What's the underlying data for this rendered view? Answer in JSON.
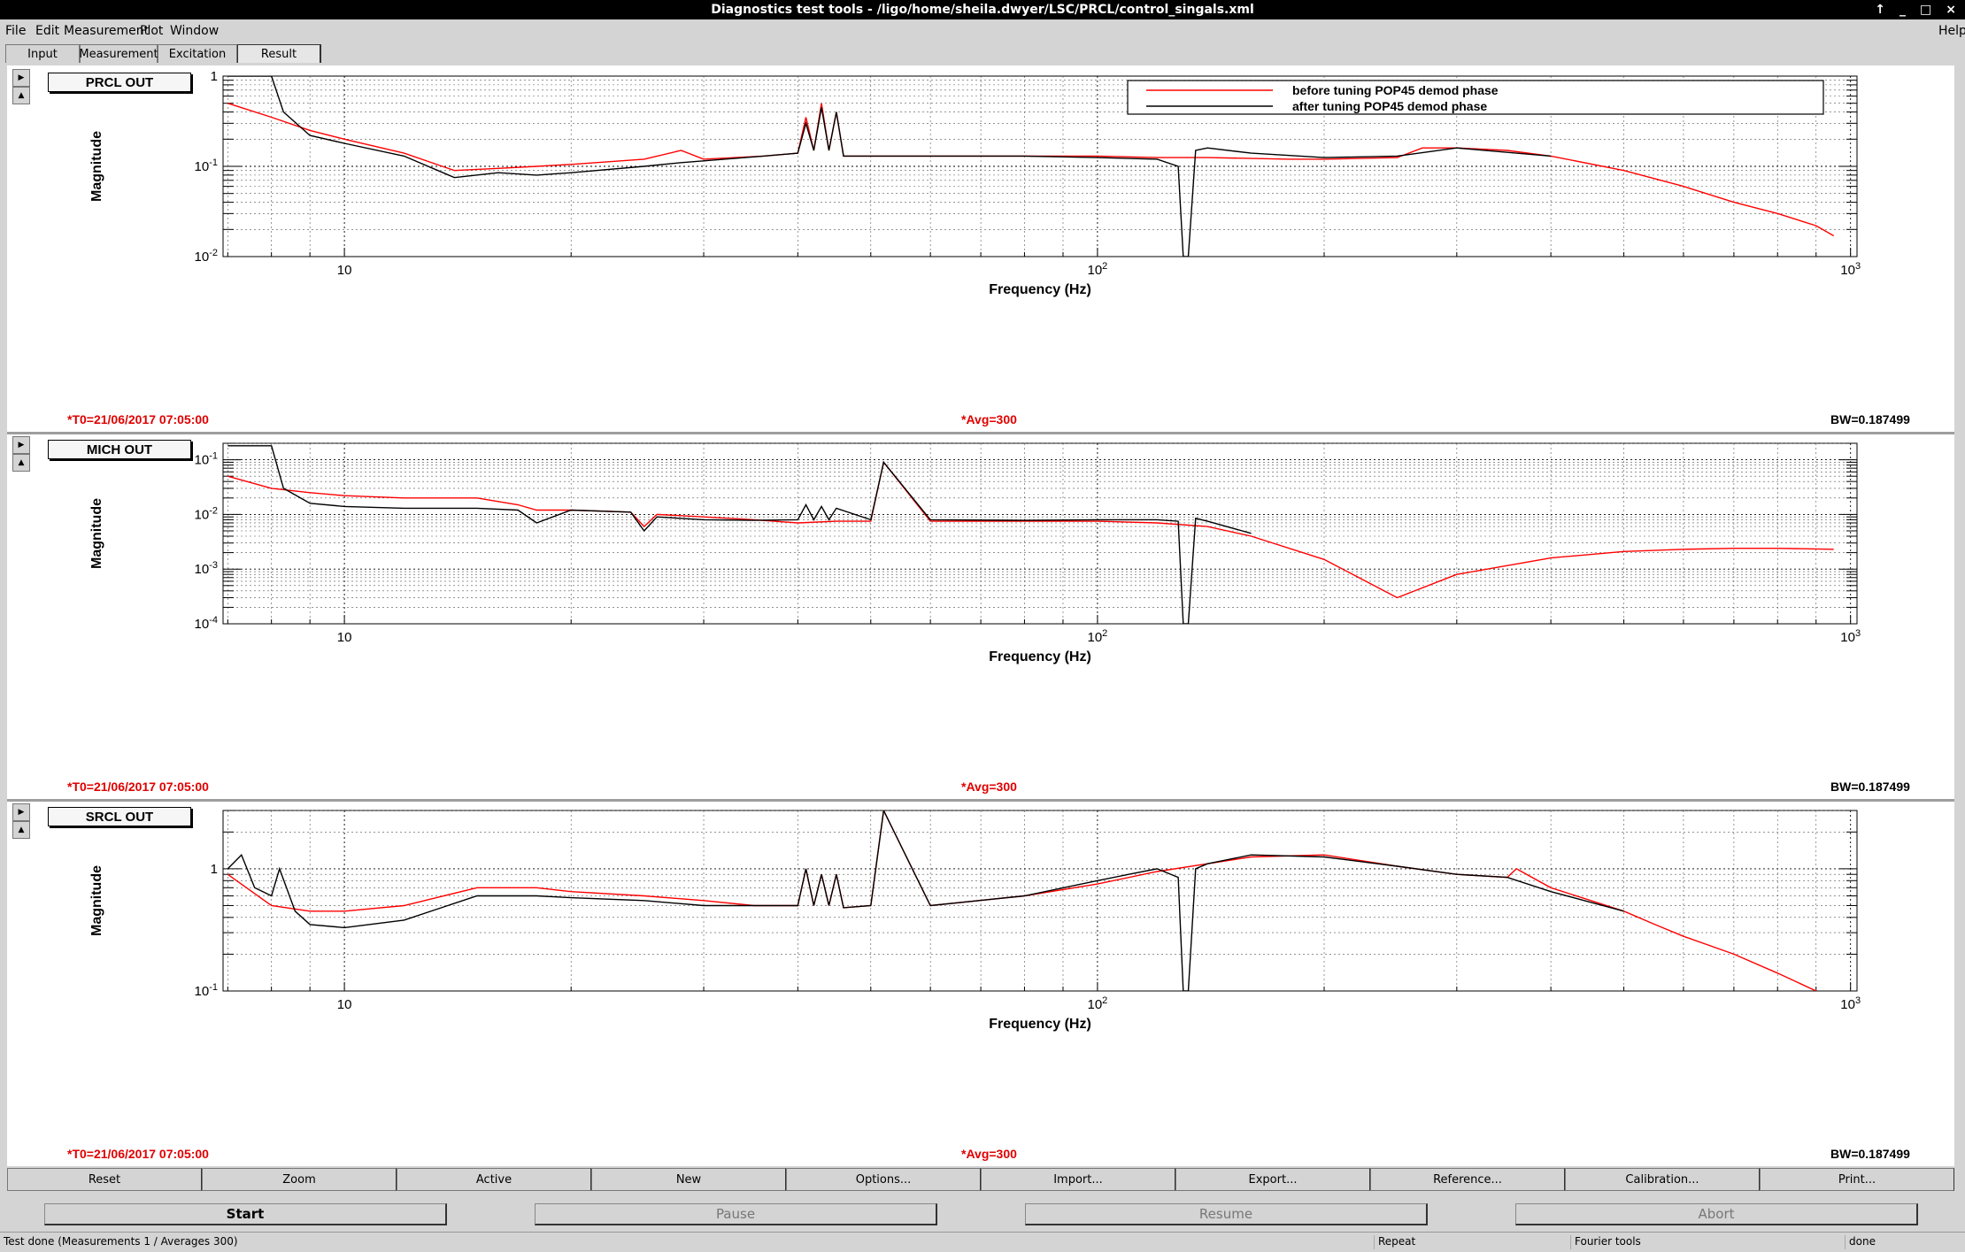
{
  "window": {
    "title": "Diagnostics test tools - /ligo/home/sheila.dwyer/LSC/PRCL/control_singals.xml",
    "controls": [
      "↑",
      "_",
      "□",
      "×"
    ]
  },
  "menu": {
    "file": "File",
    "edit": "Edit",
    "measurement": "Measurement",
    "plot": "Plot",
    "window": "Window",
    "help": "Help"
  },
  "tabs": [
    "Input",
    "Measurement",
    "Excitation",
    "Result"
  ],
  "legend": {
    "before": "before tuning POP45 demod phase",
    "after": "after tuning POP45 demod phase"
  },
  "colors": {
    "before": "#ff0000",
    "after": "#000000",
    "timestamp": "#e00000"
  },
  "plots": [
    {
      "label": "PRCL OUT",
      "ylabel": "Magnitude",
      "xlabel": "Frequency (Hz)",
      "t0": "*T0=21/06/2017 07:05:00",
      "avg": "*Avg=300",
      "bw": "BW=0.187499"
    },
    {
      "label": "MICH OUT",
      "ylabel": "Magnitude",
      "xlabel": "Frequency (Hz)",
      "t0": "*T0=21/06/2017 07:05:00",
      "avg": "*Avg=300",
      "bw": "BW=0.187499"
    },
    {
      "label": "SRCL OUT",
      "ylabel": "Magnitude",
      "xlabel": "Frequency (Hz)",
      "t0": "*T0=21/06/2017 07:05:00",
      "avg": "*Avg=300",
      "bw": "BW=0.187499"
    }
  ],
  "chart_data": [
    {
      "type": "line",
      "title": "PRCL OUT",
      "xlabel": "Frequency (Hz)",
      "ylabel": "Magnitude",
      "xscale": "log",
      "yscale": "log",
      "xlim": [
        6.9,
        1020
      ],
      "ylim": [
        0.01,
        1.0
      ],
      "xticks": [
        "10",
        "10^2",
        "10^3"
      ],
      "yticks": [
        "1",
        "10^-1",
        "10^-2"
      ],
      "grid": true,
      "legend_position": "top-right",
      "series": [
        {
          "name": "before tuning POP45 demod phase",
          "color": "#ff0000",
          "x": [
            7,
            8,
            9,
            10,
            12,
            14,
            16,
            18,
            20,
            25,
            28,
            30,
            36,
            40,
            41,
            42,
            43,
            44,
            45,
            46,
            50,
            55,
            60,
            70,
            80,
            100,
            120,
            140,
            180,
            200,
            250,
            270,
            300,
            350,
            400,
            500,
            600,
            700,
            800,
            900,
            950
          ],
          "y": [
            0.5,
            0.35,
            0.25,
            0.2,
            0.14,
            0.09,
            0.095,
            0.1,
            0.105,
            0.12,
            0.15,
            0.12,
            0.13,
            0.14,
            0.35,
            0.15,
            0.5,
            0.15,
            0.4,
            0.13,
            0.13,
            0.13,
            0.13,
            0.13,
            0.13,
            0.13,
            0.125,
            0.125,
            0.12,
            0.12,
            0.125,
            0.16,
            0.16,
            0.15,
            0.13,
            0.09,
            0.06,
            0.04,
            0.03,
            0.022,
            0.017
          ]
        },
        {
          "name": "after tuning POP45 demod phase",
          "color": "#000000",
          "x": [
            7,
            7.6,
            8,
            8.3,
            9,
            10,
            12,
            14,
            16,
            18,
            20,
            25,
            28,
            30,
            36,
            40,
            41,
            42,
            43,
            44,
            45,
            46,
            50,
            60,
            80,
            100,
            120,
            128,
            130,
            132,
            135,
            140,
            160,
            200,
            250,
            300,
            400
          ],
          "y": [
            1.0,
            1.0,
            1.0,
            0.4,
            0.22,
            0.18,
            0.13,
            0.075,
            0.085,
            0.08,
            0.085,
            0.1,
            0.11,
            0.115,
            0.13,
            0.14,
            0.3,
            0.15,
            0.45,
            0.15,
            0.4,
            0.13,
            0.13,
            0.13,
            0.13,
            0.125,
            0.12,
            0.1,
            0.01,
            0.01,
            0.15,
            0.16,
            0.14,
            0.125,
            0.13,
            0.16,
            0.13
          ]
        }
      ]
    },
    {
      "type": "line",
      "title": "MICH OUT",
      "xlabel": "Frequency (Hz)",
      "ylabel": "Magnitude",
      "xscale": "log",
      "yscale": "log",
      "xlim": [
        6.9,
        1020
      ],
      "ylim": [
        0.0001,
        0.2
      ],
      "xticks": [
        "10",
        "10^2",
        "10^3"
      ],
      "yticks": [
        "10^-1",
        "10^-2",
        "10^-3",
        "10^-4"
      ],
      "grid": true,
      "series": [
        {
          "name": "before tuning POP45 demod phase",
          "color": "#ff0000",
          "x": [
            7,
            8,
            9,
            10,
            12,
            15,
            17,
            18,
            20,
            24,
            25,
            26,
            30,
            35,
            40,
            45,
            50,
            52,
            60,
            80,
            100,
            120,
            140,
            160,
            200,
            250,
            300,
            400,
            500,
            600,
            700,
            800,
            950
          ],
          "y": [
            0.05,
            0.03,
            0.025,
            0.022,
            0.02,
            0.02,
            0.015,
            0.012,
            0.012,
            0.011,
            0.006,
            0.01,
            0.009,
            0.008,
            0.007,
            0.0075,
            0.0075,
            0.09,
            0.0075,
            0.0075,
            0.0075,
            0.007,
            0.006,
            0.004,
            0.0015,
            0.0003,
            0.0008,
            0.0016,
            0.0021,
            0.0023,
            0.0024,
            0.0024,
            0.0023
          ]
        },
        {
          "name": "after tuning POP45 demod phase",
          "color": "#000000",
          "x": [
            7,
            7.6,
            8,
            8.3,
            9,
            10,
            12,
            15,
            17,
            18,
            20,
            24,
            25,
            26,
            30,
            35,
            40,
            41,
            42,
            43,
            44,
            45,
            50,
            52,
            60,
            80,
            100,
            120,
            128,
            130,
            132,
            135,
            140,
            160
          ],
          "y": [
            0.18,
            0.18,
            0.18,
            0.03,
            0.016,
            0.014,
            0.013,
            0.013,
            0.012,
            0.007,
            0.012,
            0.011,
            0.005,
            0.009,
            0.008,
            0.0078,
            0.008,
            0.015,
            0.008,
            0.014,
            0.008,
            0.013,
            0.008,
            0.09,
            0.008,
            0.0078,
            0.008,
            0.008,
            0.0075,
            0.0001,
            0.0001,
            0.0085,
            0.0075,
            0.0045
          ]
        }
      ]
    },
    {
      "type": "line",
      "title": "SRCL OUT",
      "xlabel": "Frequency (Hz)",
      "ylabel": "Magnitude",
      "xscale": "log",
      "yscale": "log",
      "xlim": [
        6.9,
        1020
      ],
      "ylim": [
        0.1,
        3.0
      ],
      "xticks": [
        "10",
        "10^2",
        "10^3"
      ],
      "yticks": [
        "1",
        "10^-1"
      ],
      "grid": true,
      "series": [
        {
          "name": "before tuning POP45 demod phase",
          "color": "#ff0000",
          "x": [
            7,
            8,
            9,
            10,
            12,
            15,
            18,
            20,
            25,
            30,
            35,
            40,
            41,
            42,
            43,
            44,
            45,
            46,
            50,
            52,
            60,
            80,
            100,
            120,
            140,
            160,
            200,
            250,
            300,
            350,
            360,
            400,
            500,
            550,
            600,
            700,
            800,
            900
          ],
          "y": [
            0.9,
            0.5,
            0.45,
            0.45,
            0.5,
            0.7,
            0.7,
            0.65,
            0.6,
            0.55,
            0.5,
            0.5,
            1.0,
            0.5,
            0.9,
            0.5,
            0.9,
            0.48,
            0.5,
            3.0,
            0.5,
            0.6,
            0.75,
            0.95,
            1.1,
            1.25,
            1.3,
            1.05,
            0.9,
            0.85,
            1.0,
            0.7,
            0.45,
            0.35,
            0.28,
            0.2,
            0.14,
            0.1
          ]
        },
        {
          "name": "after tuning POP45 demod phase",
          "color": "#000000",
          "x": [
            7,
            7.3,
            7.6,
            8,
            8.2,
            8.6,
            9,
            10,
            12,
            15,
            18,
            20,
            25,
            30,
            35,
            40,
            41,
            42,
            43,
            44,
            45,
            46,
            50,
            52,
            60,
            80,
            100,
            110,
            120,
            128,
            130,
            132,
            135,
            140,
            160,
            200,
            250,
            300,
            350,
            400,
            500
          ],
          "y": [
            1.0,
            1.3,
            0.7,
            0.6,
            1.0,
            0.45,
            0.35,
            0.33,
            0.38,
            0.6,
            0.6,
            0.58,
            0.55,
            0.5,
            0.5,
            0.5,
            1.0,
            0.5,
            0.9,
            0.5,
            0.9,
            0.48,
            0.5,
            3.0,
            0.5,
            0.6,
            0.8,
            0.9,
            1.0,
            0.85,
            0.1,
            0.1,
            1.0,
            1.1,
            1.3,
            1.25,
            1.05,
            0.9,
            0.85,
            0.65,
            0.45
          ]
        }
      ]
    }
  ],
  "buttons1": [
    "Reset",
    "Zoom",
    "Active",
    "New",
    "Options...",
    "Import...",
    "Export...",
    "Reference...",
    "Calibration...",
    "Print..."
  ],
  "buttons2": [
    "Start",
    "Pause",
    "Resume",
    "Abort"
  ],
  "status": {
    "message": "Test done (Measurements 1 / Averages 300)",
    "mode": "Repeat",
    "tool": "Fourier tools",
    "state": "done"
  }
}
